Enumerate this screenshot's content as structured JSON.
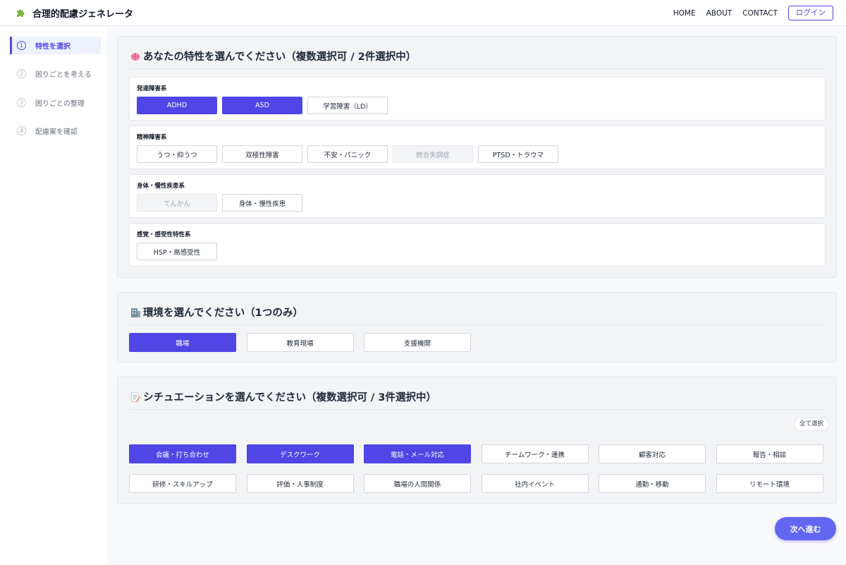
{
  "header": {
    "title": "合理的配慮ジェネレータ",
    "logo_icon": "puzzle-icon",
    "nav": [
      "HOME",
      "ABOUT",
      "CONTACT"
    ],
    "login_label": "ログイン"
  },
  "sidebar": {
    "steps": [
      {
        "num": "1",
        "label": "特性を選択",
        "active": true
      },
      {
        "num": "2",
        "label": "困りごとを考える",
        "active": false
      },
      {
        "num": "3",
        "label": "困りごとの整理",
        "active": false
      },
      {
        "num": "4",
        "label": "配慮案を確認",
        "active": false
      }
    ]
  },
  "traits": {
    "title": "あなたの特性を選んでください（複数選択可 / 2件選択中）",
    "icon": "brain-icon",
    "groups": [
      {
        "title": "発達障害系",
        "options": [
          {
            "label": "ADHD",
            "state": "selected"
          },
          {
            "label": "ASD",
            "state": "selected"
          },
          {
            "label": "学習障害（LD）",
            "state": "normal"
          }
        ]
      },
      {
        "title": "精神障害系",
        "options": [
          {
            "label": "うつ・抑うつ",
            "state": "normal"
          },
          {
            "label": "双極性障害",
            "state": "normal"
          },
          {
            "label": "不安・パニック",
            "state": "normal"
          },
          {
            "label": "統合失調症",
            "state": "disabled"
          },
          {
            "label": "PTSD・トラウマ",
            "state": "normal"
          }
        ]
      },
      {
        "title": "身体・慢性疾患系",
        "options": [
          {
            "label": "てんかん",
            "state": "disabled"
          },
          {
            "label": "身体・慢性疾患",
            "state": "normal"
          }
        ]
      },
      {
        "title": "感覚・感受性特性系",
        "options": [
          {
            "label": "HSP・高感受性",
            "state": "normal"
          }
        ]
      }
    ]
  },
  "environment": {
    "title": "環境を選んでください（1つのみ）",
    "icon": "building-icon",
    "options": [
      {
        "label": "職場",
        "state": "selected"
      },
      {
        "label": "教育現場",
        "state": "normal"
      },
      {
        "label": "支援機関",
        "state": "normal"
      }
    ]
  },
  "situations": {
    "title": "シチュエーションを選んでください（複数選択可 / 3件選択中）",
    "icon": "memo-icon",
    "select_all_label": "全て選択",
    "row1": [
      {
        "label": "会議・打ち合わせ",
        "state": "selected"
      },
      {
        "label": "デスクワーク",
        "state": "selected"
      },
      {
        "label": "電話・メール対応",
        "state": "selected"
      },
      {
        "label": "チームワーク・連携",
        "state": "normal"
      },
      {
        "label": "顧客対応",
        "state": "normal"
      },
      {
        "label": "報告・相談",
        "state": "normal"
      }
    ],
    "row2": [
      {
        "label": "研修・スキルアップ",
        "state": "normal"
      },
      {
        "label": "評価・人事制度",
        "state": "normal"
      },
      {
        "label": "職場の人間関係",
        "state": "normal"
      },
      {
        "label": "社内イベント",
        "state": "normal"
      },
      {
        "label": "通勤・移動",
        "state": "normal"
      },
      {
        "label": "リモート環境",
        "state": "normal"
      }
    ]
  },
  "next_label": "次へ進む",
  "colors": {
    "accent": "#4f46e5",
    "next_button": "#6366f1",
    "disabled": "#9ca3af"
  }
}
